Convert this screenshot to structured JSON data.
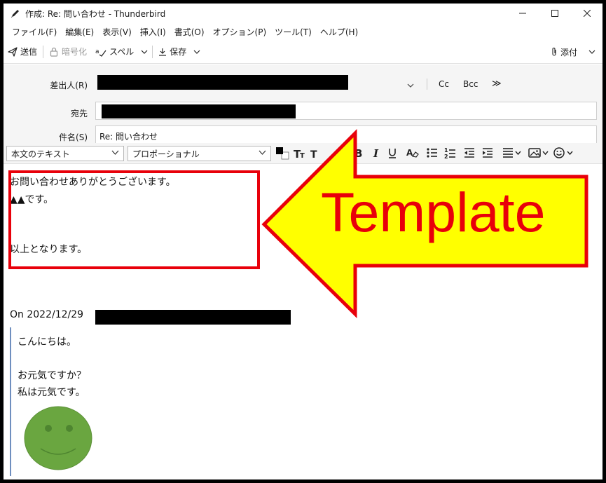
{
  "window": {
    "title": "作成: Re: 問い合わせ - Thunderbird"
  },
  "menu": [
    "ファイル(F)",
    "編集(E)",
    "表示(V)",
    "挿入(I)",
    "書式(O)",
    "オプション(P)",
    "ツール(T)",
    "ヘルプ(H)"
  ],
  "toolbar": {
    "send": "送信",
    "encrypt": "暗号化",
    "spell": "スペル",
    "save": "保存",
    "attach": "添付"
  },
  "header": {
    "from_label": "差出人(R)",
    "to_label": "宛先",
    "subject_label": "件名(S)",
    "subject_value": "Re: 問い合わせ",
    "cc": "Cc",
    "bcc": "Bcc",
    "more": "≫"
  },
  "format": {
    "paragraph_style": "本文のテキスト",
    "font": "プロポーショナル"
  },
  "body": {
    "line1": "お問い合わせありがとうございます。",
    "line2": "▲▲です。",
    "line3": "以上となります。",
    "quote_intro": "On 2022/12/29",
    "quote_line1": "こんにちは。",
    "quote_line2": "お元気ですか？",
    "quote_line3": "私は元気です。"
  },
  "annotation": {
    "label": "Template"
  },
  "colors": {
    "annotation_red": "#e8000a",
    "arrow_fill": "#ffff00",
    "smiley_green": "#6aa640"
  }
}
